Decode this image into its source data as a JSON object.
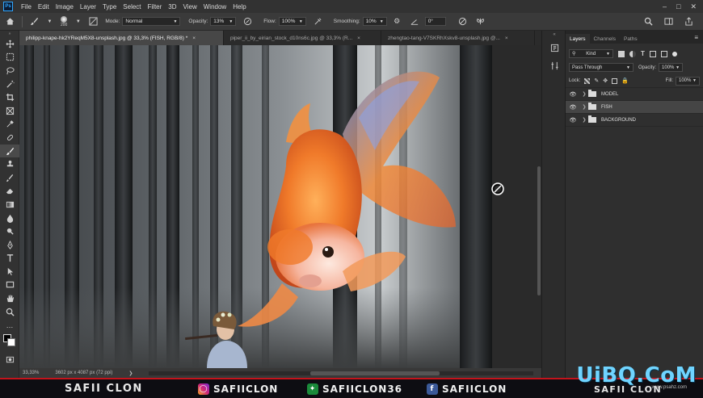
{
  "app": {
    "logo_text": "Ps",
    "menu": [
      "File",
      "Edit",
      "Image",
      "Layer",
      "Type",
      "Select",
      "Filter",
      "3D",
      "View",
      "Window",
      "Help"
    ]
  },
  "options": {
    "brush_size": "200",
    "mode_label": "Mode:",
    "mode_value": "Normal",
    "opacity_label": "Opacity:",
    "opacity_value": "13%",
    "flow_label": "Flow:",
    "flow_value": "100%",
    "smoothing_label": "Smoothing:",
    "smoothing_value": "10%",
    "angle_value": "0°"
  },
  "tabs": [
    {
      "label": "philipp-knape-hk2YReqM5X8-unsplash.jpg @ 33,3% (FISH, RGB/8) *"
    },
    {
      "label": "piper_ii_by_eirian_stock_d10ns6c.jpg @ 33,3% (R..."
    },
    {
      "label": "zhengtao-tang-V7SKRhXskv8-unsplash.jpg @..."
    }
  ],
  "status": {
    "zoom": "33,33%",
    "doc_size": "3602 px x 4087 px (72 ppi)"
  },
  "panel": {
    "tabs": [
      "Layers",
      "Channels",
      "Paths"
    ],
    "kind_label": "Kind",
    "blend_mode": "Pass Through",
    "opacity_label": "Opacity:",
    "opacity_value": "100%",
    "lock_label": "Lock:",
    "fill_label": "Fill:",
    "fill_value": "100%",
    "layers": [
      {
        "name": "MODEL",
        "selected": false
      },
      {
        "name": "FISH",
        "selected": true
      },
      {
        "name": "BACKGROUND",
        "selected": false
      }
    ]
  },
  "banner": {
    "brand": "SAFII CLON",
    "instagram": "SAFIICLON",
    "twitter": "SAFIICLON36",
    "facebook": "SAFIICLON",
    "brand_right": "SAFII CLON",
    "watermark": "UiBQ.CoM",
    "watermark_sub": "www.psahz.com"
  },
  "colors": {
    "accent_blue": "#31a8ff",
    "banner_red": "#c4141c",
    "fish_orange": "#f07a2a"
  }
}
